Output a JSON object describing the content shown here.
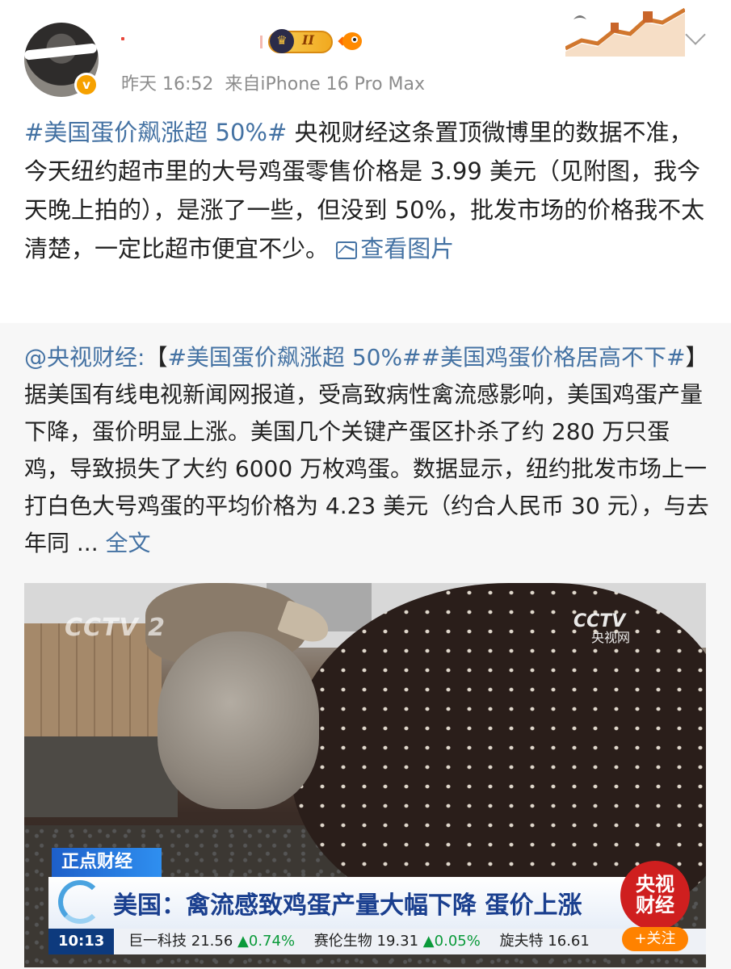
{
  "post": {
    "time": "昨天 16:52",
    "source": "来自iPhone 16 Pro Max",
    "vip_level": "II",
    "tag": "#美国蛋价飙涨超 50%#",
    "body": " 央视财经这条置顶微博里的数据不准，今天纽约超市里的大号鸡蛋零售价格是 3.99 美元（见附图，我今天晚上拍的），是涨了一些，但没到 50%，批发市场的价格我不太清楚，一定比超市便宜不少。",
    "view_images": "查看图片"
  },
  "repost": {
    "author": "@央视财经:",
    "bracket_open": "【",
    "tag1": "#美国蛋价飙涨超 50%#",
    "tag2": "#美国鸡蛋价格居高不下#",
    "body": "】据美国有线电视新闻网报道，受高致病性禽流感影响，美国鸡蛋产量下降，蛋价明显上涨。美国几个关键产蛋区扑杀了约 280 万只蛋鸡，导致损失了大约 6000 万枚鸡蛋。数据显示，纽约批发市场上一打白色大号鸡蛋的平均价格为 4.23 美元（约合人民币 30 元），与去年同 ... ",
    "full_text": "全文"
  },
  "video": {
    "cctv_left": "CCTV 2",
    "cctv_right": "CCTV",
    "cctv_right_sub": "央视网",
    "program": "正点财经",
    "headline": "美国：禽流感致鸡蛋产量大幅下降  蛋价上涨",
    "ticker": {
      "time": "10:13",
      "items": [
        {
          "name": "巨一科技",
          "price": "21.56",
          "change": "▲0.74%"
        },
        {
          "name": "赛伦生物",
          "price": "19.31",
          "change": "▲0.05%"
        },
        {
          "name": "旋夫特",
          "price": "16.61",
          "change": ""
        }
      ]
    },
    "badge_line1": "央视",
    "badge_line2": "财经",
    "follow": "+关注"
  },
  "colors": {
    "link": "#4472a3",
    "meta": "#8c8c8c",
    "repost_bg": "#f7f7f7",
    "follow": "#ff8200"
  }
}
